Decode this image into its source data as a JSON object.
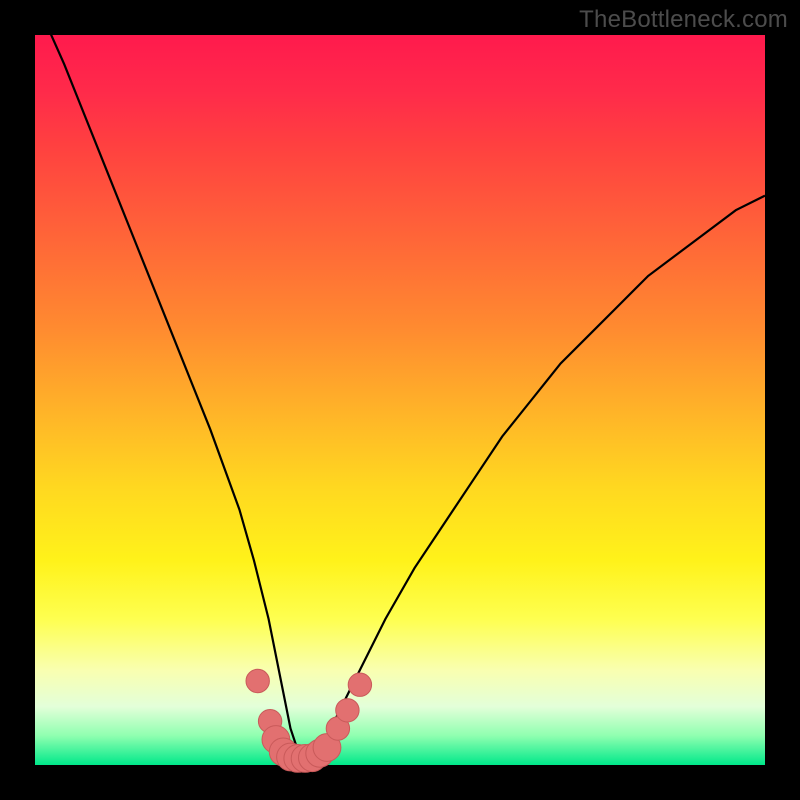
{
  "watermark": "TheBottleneck.com",
  "colors": {
    "frame": "#000000",
    "curve": "#000000",
    "marker_fill": "#e27070",
    "marker_stroke": "#c95a5a",
    "green": "#00e88a",
    "red": "#ff1a4d"
  },
  "chart_data": {
    "type": "line",
    "title": "",
    "xlabel": "",
    "ylabel": "",
    "xlim": [
      0,
      100
    ],
    "ylim": [
      0,
      100
    ],
    "grid": false,
    "legend": false,
    "series": [
      {
        "name": "bottleneck-curve",
        "x": [
          0,
          4,
          8,
          12,
          16,
          20,
          24,
          28,
          30,
          32,
          33,
          34,
          35,
          36,
          37,
          38,
          39,
          40,
          42,
          44,
          48,
          52,
          56,
          60,
          64,
          68,
          72,
          76,
          80,
          84,
          88,
          92,
          96,
          100
        ],
        "y": [
          105,
          96,
          86,
          76,
          66,
          56,
          46,
          35,
          28,
          20,
          15,
          10,
          5,
          2,
          1,
          1,
          2,
          4,
          8,
          12,
          20,
          27,
          33,
          39,
          45,
          50,
          55,
          59,
          63,
          67,
          70,
          73,
          76,
          78
        ]
      }
    ],
    "markers": [
      {
        "x": 30.5,
        "y": 11.5,
        "r": 1.6
      },
      {
        "x": 32.2,
        "y": 6.0,
        "r": 1.6
      },
      {
        "x": 33.0,
        "y": 3.5,
        "r": 1.9
      },
      {
        "x": 34.0,
        "y": 1.8,
        "r": 1.9
      },
      {
        "x": 35.0,
        "y": 1.1,
        "r": 1.9
      },
      {
        "x": 36.0,
        "y": 0.9,
        "r": 1.9
      },
      {
        "x": 37.0,
        "y": 0.9,
        "r": 1.9
      },
      {
        "x": 38.0,
        "y": 1.0,
        "r": 1.9
      },
      {
        "x": 39.0,
        "y": 1.6,
        "r": 1.9
      },
      {
        "x": 40.0,
        "y": 2.4,
        "r": 1.9
      },
      {
        "x": 41.5,
        "y": 5.0,
        "r": 1.6
      },
      {
        "x": 42.8,
        "y": 7.5,
        "r": 1.6
      },
      {
        "x": 44.5,
        "y": 11.0,
        "r": 1.6
      }
    ]
  }
}
